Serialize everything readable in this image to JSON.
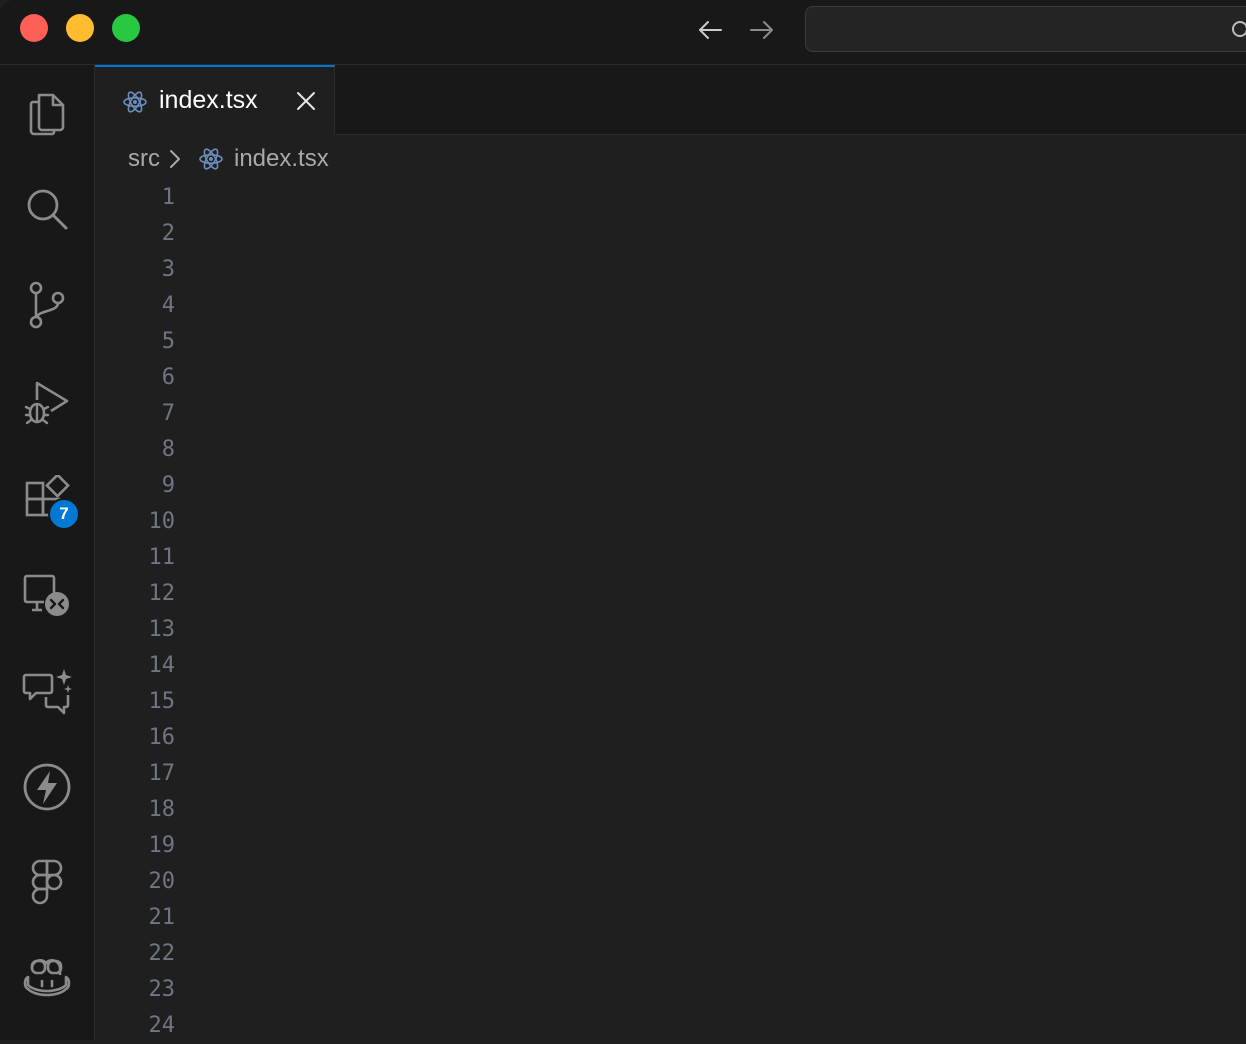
{
  "window": {
    "traffic_lights": [
      "close",
      "minimize",
      "zoom"
    ],
    "nav": {
      "back_icon": "arrow-left-icon",
      "forward_icon": "arrow-right-icon"
    },
    "command_center": {
      "icon": "search-icon",
      "text": ""
    }
  },
  "activity_bar": {
    "items": [
      {
        "name": "explorer",
        "icon": "files-icon"
      },
      {
        "name": "search",
        "icon": "search-icon"
      },
      {
        "name": "source-control",
        "icon": "source-control-icon"
      },
      {
        "name": "run-and-debug",
        "icon": "debug-icon"
      },
      {
        "name": "extensions",
        "icon": "extensions-icon",
        "badge": "7"
      },
      {
        "name": "remote-explorer",
        "icon": "remote-icon"
      },
      {
        "name": "chat",
        "icon": "chat-sparkle-icon"
      },
      {
        "name": "lightning",
        "icon": "lightning-icon"
      },
      {
        "name": "figma",
        "icon": "figma-icon"
      },
      {
        "name": "copilot",
        "icon": "copilot-icon"
      }
    ],
    "badge_color": "#0078d4"
  },
  "tabs": [
    {
      "label": "index.tsx",
      "icon": "react-icon",
      "active": true
    }
  ],
  "breadcrumb": {
    "folder": "src",
    "file": "index.tsx"
  },
  "editor": {
    "line_numbers": [
      "1",
      "2",
      "3",
      "4",
      "5",
      "6",
      "7",
      "8",
      "9",
      "10",
      "11",
      "12",
      "13",
      "14",
      "15",
      "16",
      "17",
      "18",
      "19",
      "20",
      "21",
      "22",
      "23",
      "24"
    ]
  },
  "colors": {
    "accent": "#0078d4",
    "background": "#1f1f1f",
    "sidebar": "#181818"
  }
}
